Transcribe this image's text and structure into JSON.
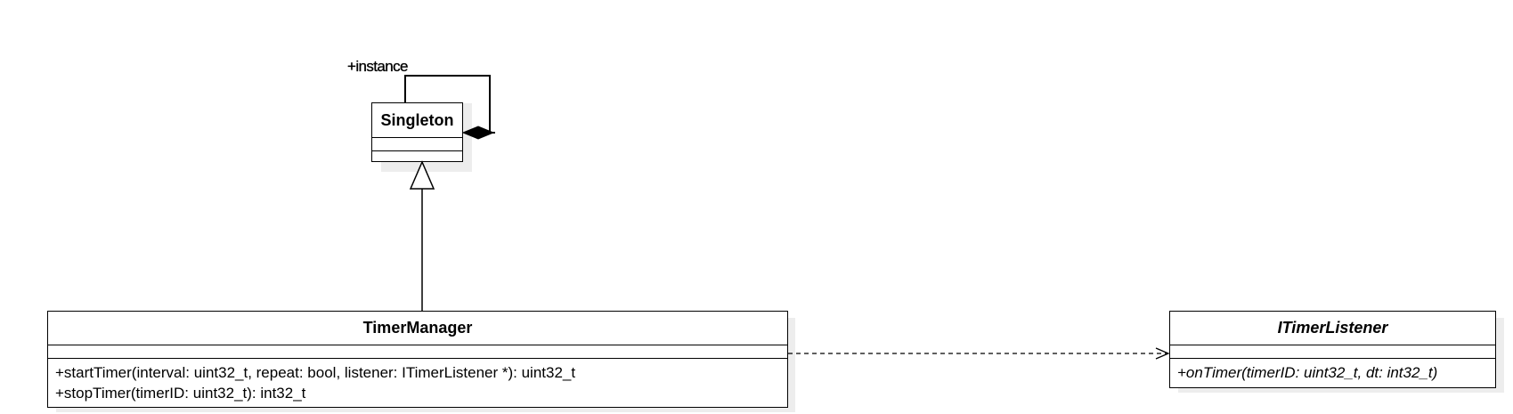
{
  "classes": {
    "singleton": {
      "name": "Singleton"
    },
    "timer_manager": {
      "name": "TimerManager",
      "operations": [
        "+startTimer(interval: uint32_t, repeat: bool, listener: ITimerListener *): uint32_t",
        "+stopTimer(timerID: uint32_t): int32_t"
      ]
    },
    "timer_listener": {
      "name": "ITimerListener",
      "abstract": true,
      "operations": [
        "+onTimer(timerID: uint32_t, dt: int32_t)"
      ]
    }
  },
  "relationships": {
    "self_composition": {
      "role": "+instance",
      "type": "composition"
    },
    "generalization": {
      "from": "TimerManager",
      "to": "Singleton",
      "type": "inheritance"
    },
    "dependency": {
      "from": "TimerManager",
      "to": "ITimerListener",
      "type": "dependency"
    }
  }
}
